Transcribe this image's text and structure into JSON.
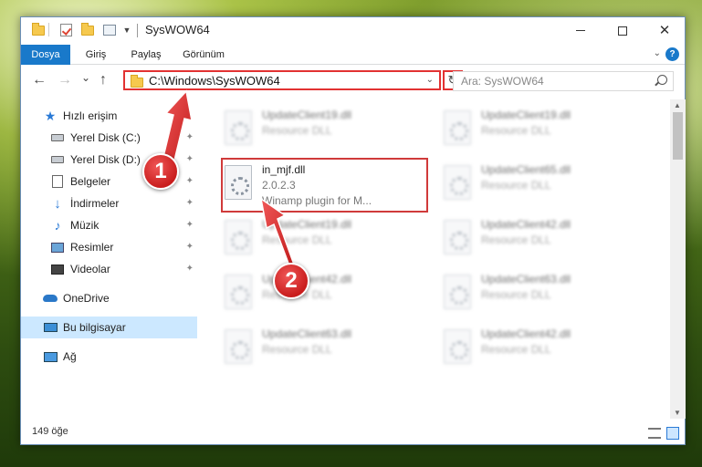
{
  "window": {
    "title": "SysWOW64",
    "minimize_glyph": "—",
    "maximize_glyph": "☐",
    "close_glyph": "✕"
  },
  "ribbon": {
    "tabs": [
      "Dosya",
      "Giriş",
      "Paylaş",
      "Görünüm"
    ],
    "active_tab": "Dosya",
    "help_glyph": "?"
  },
  "nav": {
    "back_glyph": "←",
    "forward_glyph": "→",
    "recent_glyph": "⌄",
    "up_glyph": "↑",
    "address": "C:\\Windows\\SysWOW64",
    "address_dropdown_glyph": "⌄",
    "refresh_glyph": "↻",
    "search_placeholder": "Ara: SysWOW64"
  },
  "sidebar": {
    "items": [
      {
        "label": "Hızlı erişim",
        "icon": "star-icon"
      },
      {
        "label": "Yerel Disk (C:)",
        "icon": "disk-icon",
        "pinned": true
      },
      {
        "label": "Yerel Disk (D:)",
        "icon": "disk-icon",
        "pinned": true
      },
      {
        "label": "Belgeler",
        "icon": "documents-icon",
        "pinned": true
      },
      {
        "label": "İndirmeler",
        "icon": "download-icon",
        "pinned": true
      },
      {
        "label": "Müzik",
        "icon": "music-icon",
        "pinned": true
      },
      {
        "label": "Resimler",
        "icon": "pictures-icon",
        "pinned": true
      },
      {
        "label": "Videolar",
        "icon": "videos-icon",
        "pinned": true
      },
      {
        "label": "OneDrive",
        "icon": "onedrive-icon"
      },
      {
        "label": "Bu bilgisayar",
        "icon": "computer-icon",
        "selected": true
      },
      {
        "label": "Ağ",
        "icon": "network-icon"
      }
    ],
    "pin_glyph": "📌"
  },
  "files": {
    "left": [
      {
        "name": "UpdateClient19.dll",
        "type": "Resource DLL"
      },
      {
        "name": "in_mjf.dll",
        "version": "2.0.2.3",
        "desc": "Winamp plugin for M..."
      },
      {
        "name": "UpdateClient19.dll",
        "type": "Resource DLL"
      },
      {
        "name": "UpdateClient42.dll",
        "type": "Resource DLL"
      },
      {
        "name": "UpdateClient63.dll",
        "type": "Resource DLL"
      }
    ],
    "right": [
      {
        "name": "UpdateClient19.dll",
        "type": "Resource DLL"
      },
      {
        "name": "UpdateClient65.dll",
        "type": "Resource DLL"
      },
      {
        "name": "UpdateClient42.dll",
        "type": "Resource DLL"
      },
      {
        "name": "UpdateClient63.dll",
        "type": "Resource DLL"
      },
      {
        "name": "UpdateClient42.dll",
        "type": "Resource DLL"
      }
    ]
  },
  "status": {
    "item_count": "149 öğe"
  },
  "scroll": {
    "up_glyph": "▲",
    "down_glyph": "▼"
  },
  "callouts": {
    "one": "1",
    "two": "2"
  },
  "colors": {
    "accent": "#1979ca",
    "highlight": "#e23232"
  }
}
